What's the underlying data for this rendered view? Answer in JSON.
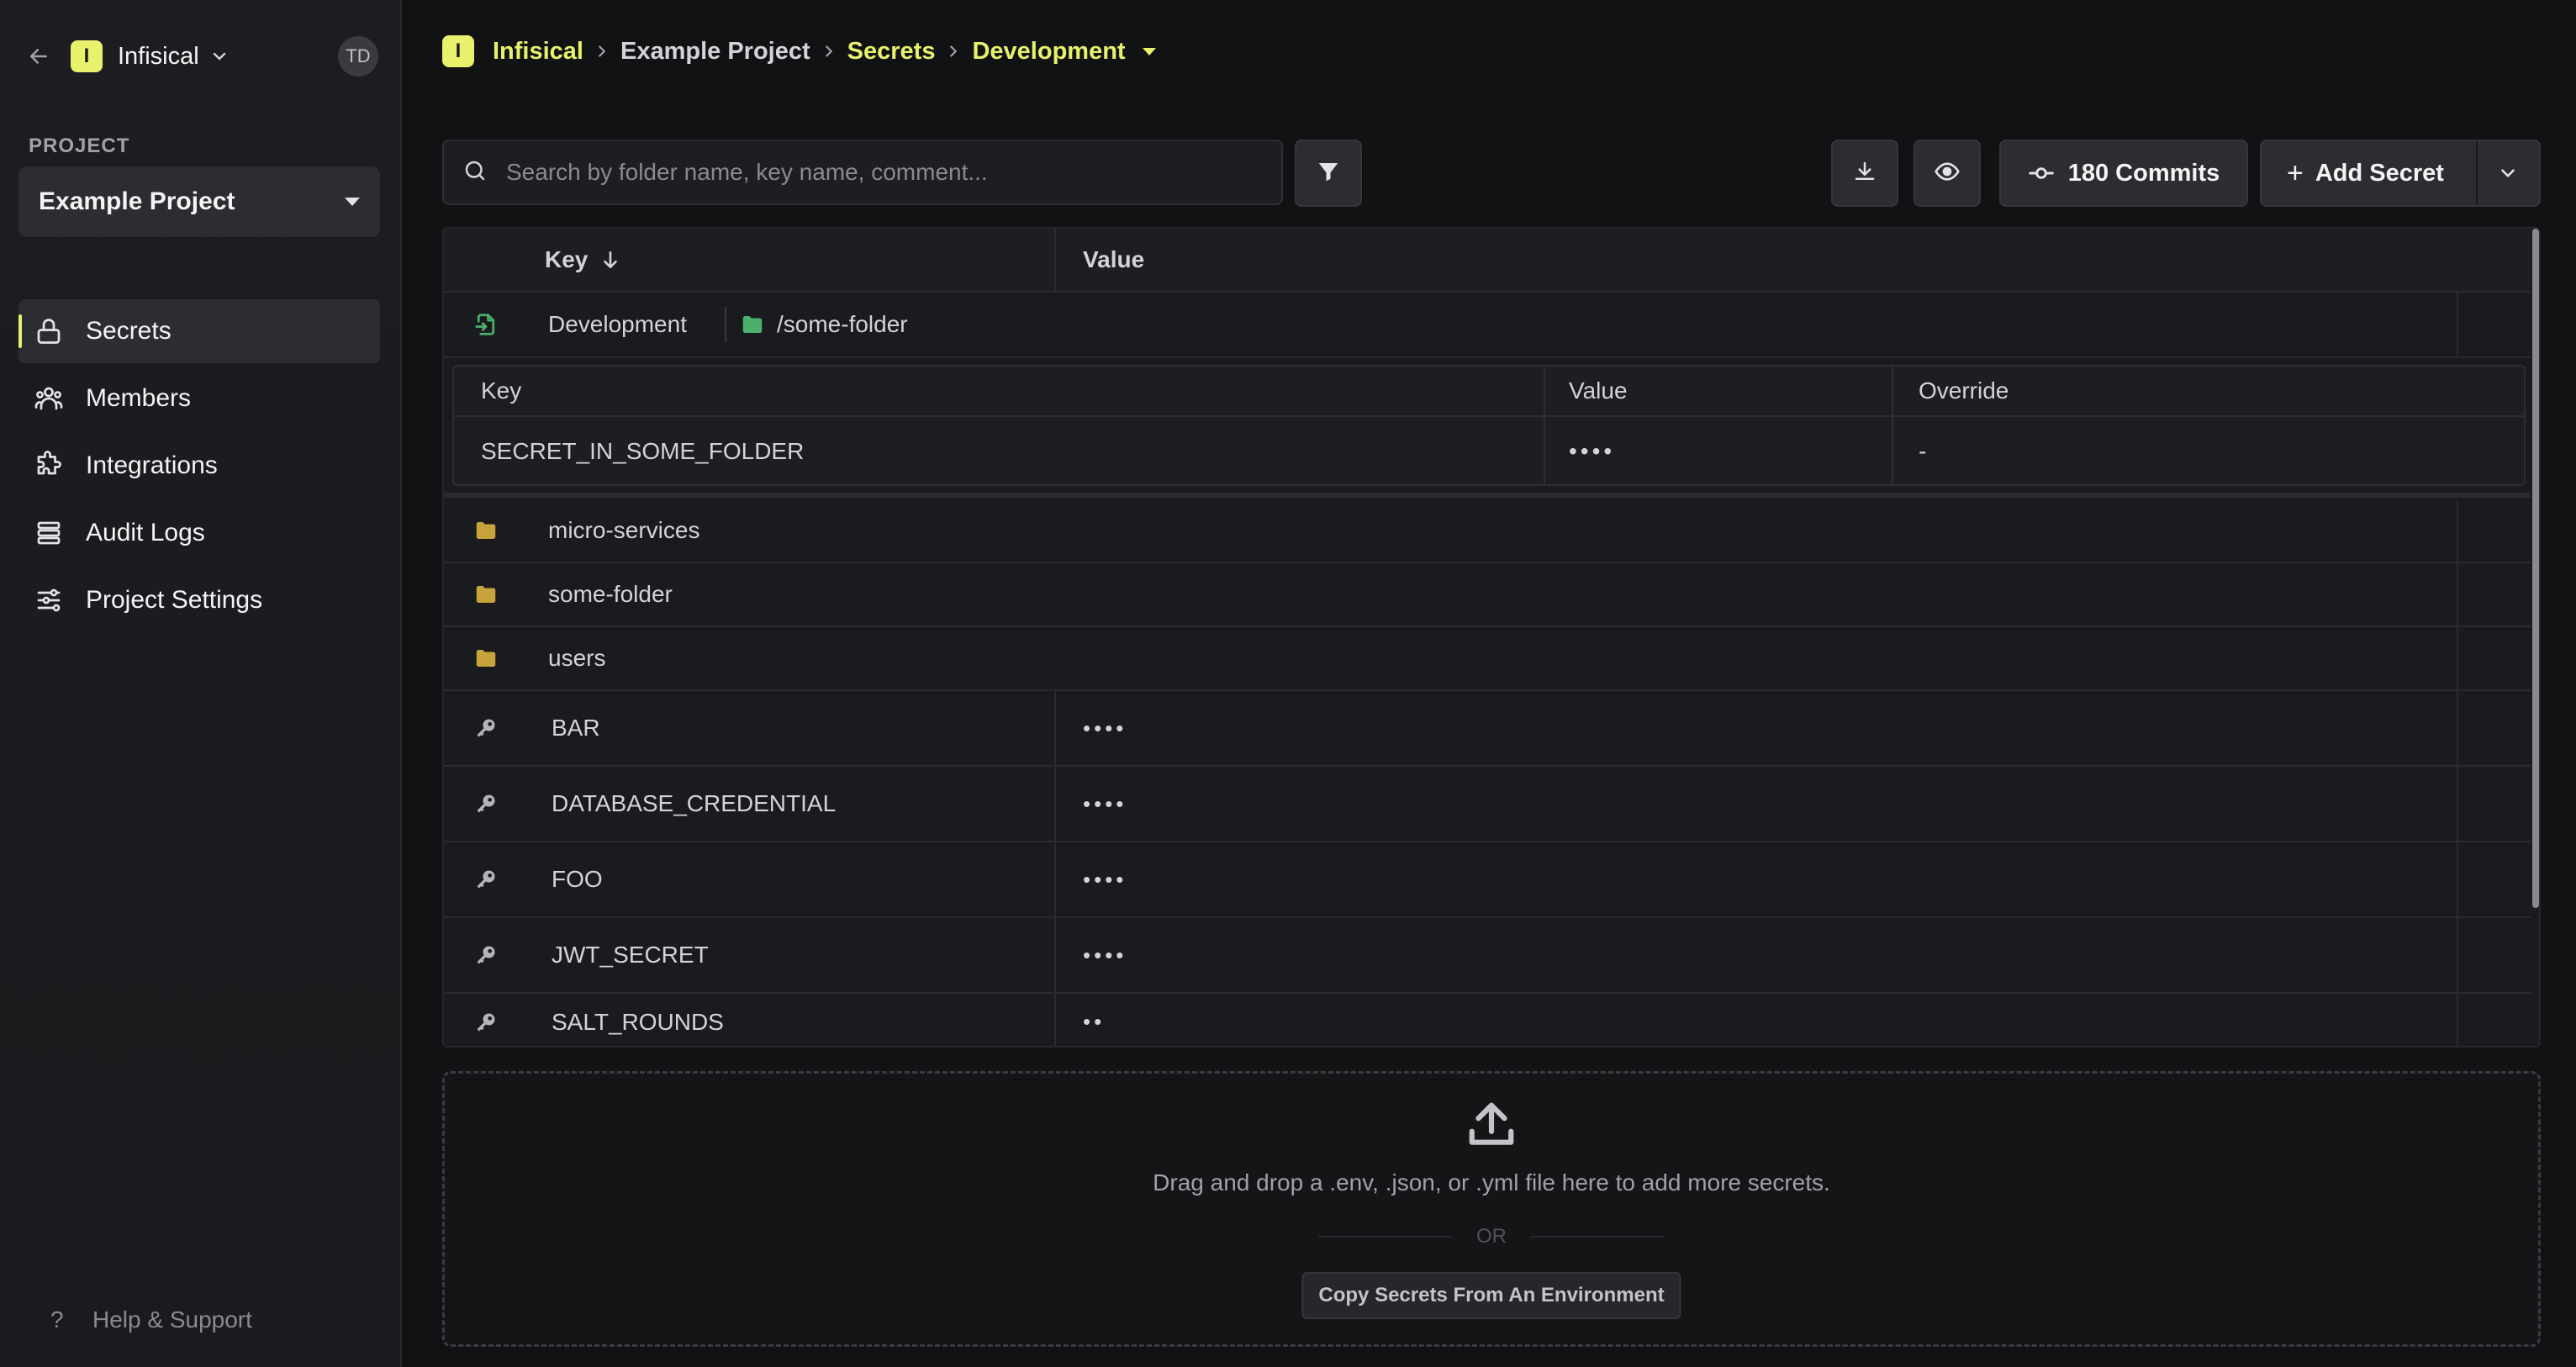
{
  "sidebar": {
    "org_initial": "I",
    "org_name": "Infisical",
    "avatar_initials": "TD",
    "project_label": "PROJECT",
    "project_name": "Example Project",
    "nav": [
      {
        "label": "Secrets",
        "icon": "lock-icon",
        "active": true
      },
      {
        "label": "Members",
        "icon": "users-icon"
      },
      {
        "label": "Integrations",
        "icon": "puzzle-icon"
      },
      {
        "label": "Audit Logs",
        "icon": "list-icon"
      },
      {
        "label": "Project Settings",
        "icon": "sliders-icon"
      }
    ],
    "help_label": "Help & Support"
  },
  "breadcrumb": {
    "logo_initial": "I",
    "org": "Infisical",
    "project": "Example Project",
    "section": "Secrets",
    "environment": "Development"
  },
  "toolbar": {
    "search_placeholder": "Search by folder name, key name, comment...",
    "commits_label": "180 Commits",
    "add_secret_label": "Add Secret"
  },
  "table": {
    "col_key": "Key",
    "col_value": "Value",
    "import": {
      "environment": "Development",
      "path": "/some-folder",
      "sub_headers": {
        "key": "Key",
        "value": "Value",
        "override": "Override"
      },
      "secret": {
        "key": "SECRET_IN_SOME_FOLDER",
        "value": "••••",
        "override": "-"
      }
    },
    "folders": [
      "micro-services",
      "some-folder",
      "users"
    ],
    "secrets": [
      {
        "key": "BAR",
        "value": "••••"
      },
      {
        "key": "DATABASE_CREDENTIAL",
        "value": "••••"
      },
      {
        "key": "FOO",
        "value": "••••"
      },
      {
        "key": "JWT_SECRET",
        "value": "••••"
      },
      {
        "key": "SALT_ROUNDS",
        "value": "••"
      }
    ]
  },
  "dropzone": {
    "text": "Drag and drop a .env, .json, or .yml file here to add more secrets.",
    "or": "OR",
    "copy_button": "Copy Secrets From An Environment"
  },
  "colors": {
    "accent": "#e8f06c",
    "folder": "#c8a23a",
    "import_green": "#4caf6a"
  }
}
